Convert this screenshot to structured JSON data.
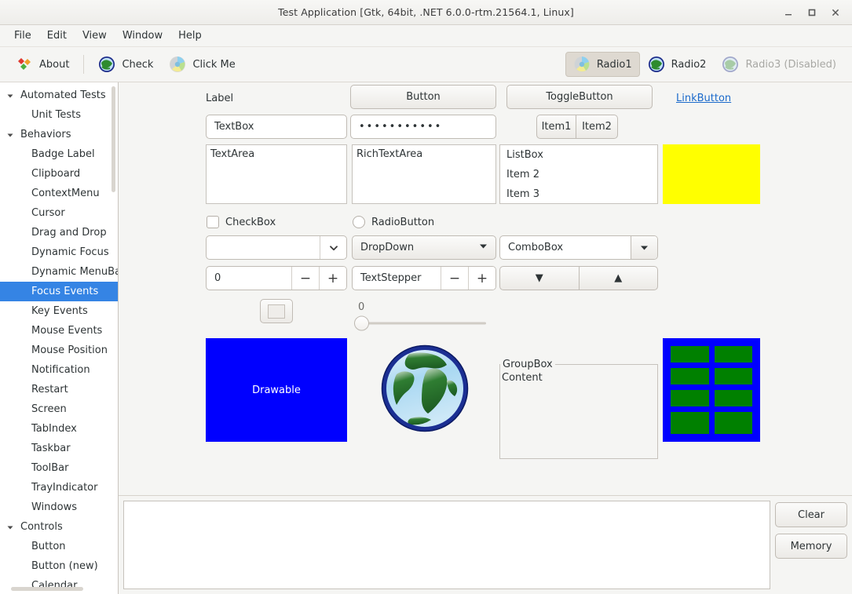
{
  "window": {
    "title": "Test Application [Gtk, 64bit, .NET 6.0.0-rtm.21564.1, Linux]",
    "minimize_label": "minimize-icon",
    "maximize_label": "maximize-icon",
    "close_label": "close-icon"
  },
  "menubar": {
    "items": [
      {
        "label": "File"
      },
      {
        "label": "Edit"
      },
      {
        "label": "View"
      },
      {
        "label": "Window"
      },
      {
        "label": "Help"
      }
    ]
  },
  "toolbar": {
    "left_items": [
      {
        "label": "About",
        "icon": "diamonds-icon"
      },
      {
        "label": "Check",
        "icon": "globe-icon"
      },
      {
        "label": "Click Me",
        "icon": "color-wheel-icon"
      }
    ],
    "radios": [
      {
        "label": "Radio1",
        "icon": "color-wheel-icon",
        "selected": true,
        "disabled": false
      },
      {
        "label": "Radio2",
        "icon": "globe-icon",
        "selected": false,
        "disabled": false
      },
      {
        "label": "Radio3 (Disabled)",
        "icon": "globe-icon",
        "selected": false,
        "disabled": true
      }
    ]
  },
  "sidebar": {
    "nodes": [
      {
        "label": "Automated Tests",
        "type": "group",
        "expanded": true,
        "selected": false
      },
      {
        "label": "Unit Tests",
        "type": "child",
        "selected": false
      },
      {
        "label": "Behaviors",
        "type": "group",
        "expanded": true,
        "selected": false
      },
      {
        "label": "Badge Label",
        "type": "child",
        "selected": false
      },
      {
        "label": "Clipboard",
        "type": "child",
        "selected": false
      },
      {
        "label": "ContextMenu",
        "type": "child",
        "selected": false
      },
      {
        "label": "Cursor",
        "type": "child",
        "selected": false
      },
      {
        "label": "Drag and Drop",
        "type": "child",
        "selected": false
      },
      {
        "label": "Dynamic Focus",
        "type": "child",
        "selected": false
      },
      {
        "label": "Dynamic MenuBa",
        "type": "child",
        "selected": false
      },
      {
        "label": "Focus Events",
        "type": "child",
        "selected": true
      },
      {
        "label": "Key Events",
        "type": "child",
        "selected": false
      },
      {
        "label": "Mouse Events",
        "type": "child",
        "selected": false
      },
      {
        "label": "Mouse Position",
        "type": "child",
        "selected": false
      },
      {
        "label": "Notification",
        "type": "child",
        "selected": false
      },
      {
        "label": "Restart",
        "type": "child",
        "selected": false
      },
      {
        "label": "Screen",
        "type": "child",
        "selected": false
      },
      {
        "label": "TabIndex",
        "type": "child",
        "selected": false
      },
      {
        "label": "Taskbar",
        "type": "child",
        "selected": false
      },
      {
        "label": "ToolBar",
        "type": "child",
        "selected": false
      },
      {
        "label": "TrayIndicator",
        "type": "child",
        "selected": false
      },
      {
        "label": "Windows",
        "type": "child",
        "selected": false
      },
      {
        "label": "Controls",
        "type": "group",
        "expanded": true,
        "selected": false
      },
      {
        "label": "Button",
        "type": "child",
        "selected": false
      },
      {
        "label": "Button (new)",
        "type": "child",
        "selected": false
      },
      {
        "label": "Calendar",
        "type": "child",
        "selected": false
      }
    ]
  },
  "content": {
    "label": "Label",
    "button": "Button",
    "toggle_button": "ToggleButton",
    "link_button": "LinkButton",
    "textbox_value": "TextBox",
    "password_value": "•••••••••••",
    "segmented": [
      {
        "label": "Item1"
      },
      {
        "label": "Item2"
      }
    ],
    "textarea_value": "TextArea",
    "richtextarea_value": "RichTextArea",
    "listbox_items": [
      {
        "label": "ListBox"
      },
      {
        "label": "Item 2"
      },
      {
        "label": "Item 3"
      }
    ],
    "color_swatch": "#ffff00",
    "checkbox_label": "CheckBox",
    "checkbox_checked": false,
    "radiobutton_label": "RadioButton",
    "radiobutton_checked": false,
    "editable_combo_value": "",
    "dropdown_value": "DropDown",
    "combobox_value": "ComboBox",
    "numeric_stepper_value": "0",
    "text_stepper_value": "TextStepper",
    "stepper_minus": "−",
    "stepper_plus": "+",
    "arrow_down": "▼",
    "arrow_up": "▲",
    "slider_value": "0",
    "drawable_label": "Drawable",
    "image_icon": "globe-image",
    "groupbox_title": "GroupBox",
    "groupbox_content": "Content",
    "pixel_layout": {
      "border_color": "#0000ff",
      "cell_color": "#008000",
      "rows": 4,
      "cols": 2
    }
  },
  "log": {
    "text": "",
    "clear_label": "Clear",
    "memory_label": "Memory"
  },
  "colors": {
    "selection": "#3584e4",
    "link": "#1b6acb",
    "yellow": "#ffff00",
    "blue": "#0000ff",
    "green": "#008000",
    "chrome": "#f5f5f3"
  }
}
